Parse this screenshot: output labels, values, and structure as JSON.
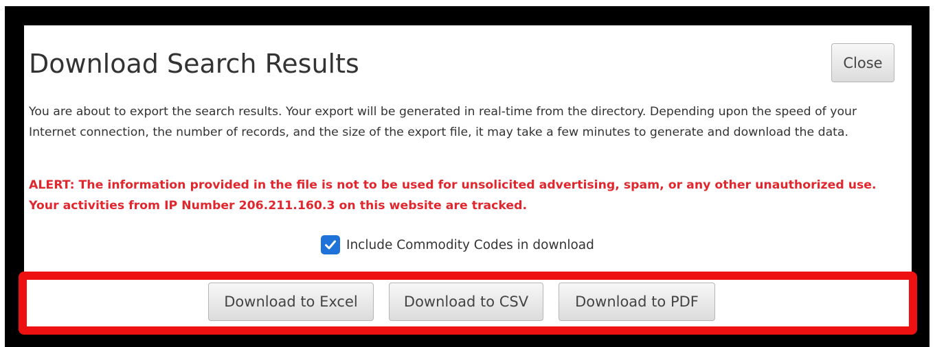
{
  "dialog": {
    "title": "Download Search Results",
    "close_label": "Close",
    "description": "You are about to export the search results. Your export will be generated in real-time from the directory. Depending upon the speed of your Internet connection, the number of records, and the size of the export file, it may take a few minutes to generate and download the data.",
    "alert": "ALERT: The information provided in the file is not to be used for unsolicited advertising, spam, or any other unauthorized use. Your activities from IP Number 206.211.160.3 on this website are tracked.",
    "include_codes": {
      "label": "Include Commodity Codes in download",
      "checked": true,
      "icon": "checkmark-icon"
    }
  },
  "downloads": {
    "excel_label": "Download to Excel",
    "csv_label": "Download to CSV",
    "pdf_label": "Download to PDF"
  },
  "colors": {
    "alert": "#e0272e",
    "highlight_border": "#ee1111",
    "checkbox": "#1f73d8",
    "frame": "#000000"
  }
}
